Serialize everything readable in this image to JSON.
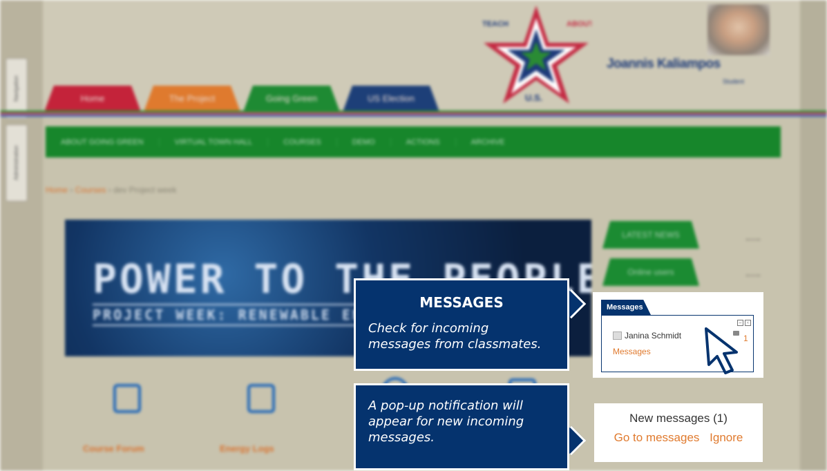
{
  "site": {
    "tabs": [
      "Home",
      "The Project",
      "Going Green",
      "US Election"
    ],
    "nav": [
      "ABOUT GOING GREEN",
      "VIRTUAL TOWN HALL",
      "COURSES",
      "DEMO",
      "ACTIONS",
      "ARCHIVE"
    ],
    "breadcrumb": [
      "Home",
      "Courses",
      "dev Project week"
    ],
    "side_tabs": [
      "Navigation",
      "Administration"
    ],
    "logo": {
      "left": "TEACH",
      "right": "ABOUT",
      "bottom": "U.S."
    },
    "user": {
      "name": "Joannis Kaliampos",
      "role": "Student"
    },
    "banner": {
      "title": "POWER TO THE PEOPLE",
      "subtitle": "PROJECT WEEK: RENEWABLE ENERGY"
    },
    "blocks": [
      "LATEST NEWS",
      "Online users"
    ],
    "icons": [
      "Course Forum",
      "Energy Logs"
    ]
  },
  "callout_messages": {
    "title": "MESSAGES",
    "text_line1": "Check for incoming",
    "text_line2": "messages from classmates."
  },
  "callout_popup": {
    "line1": "A pop-up notification will",
    "line2": "appear for new incoming",
    "line3": "messages."
  },
  "messages_block": {
    "tab_label": "Messages",
    "user": "Janina Schmidt",
    "link": "Messages",
    "count": "1"
  },
  "notification": {
    "title": "New messages (1)",
    "go_label": "Go to messages",
    "ignore_label": "Ignore"
  },
  "colors": {
    "callout_bg": "#05336e",
    "accent_orange": "#e07a2e",
    "nav_green": "#17862b"
  }
}
